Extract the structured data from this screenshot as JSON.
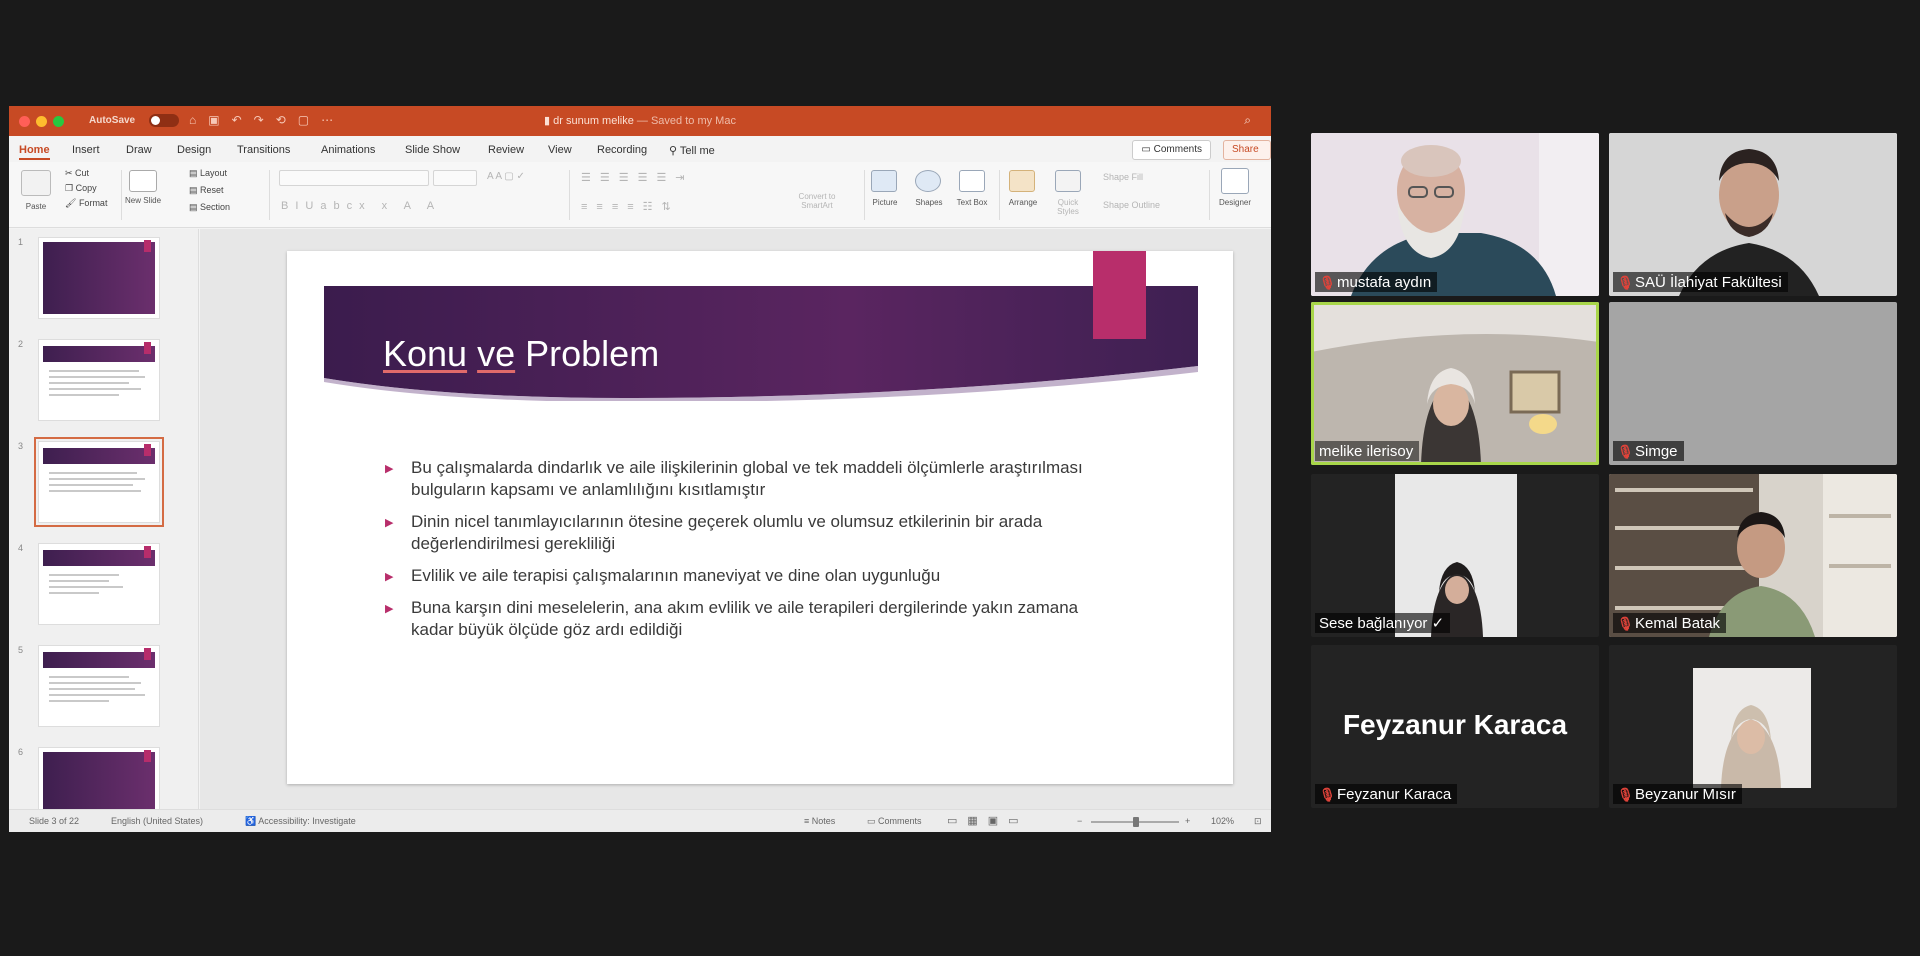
{
  "powerpoint": {
    "titlebar": {
      "autosave_label": "AutoSave",
      "autosave_state": "OFF",
      "document_title": "dr sunum melike",
      "saved_status": "— Saved to my Mac"
    },
    "tabs": [
      "Home",
      "Insert",
      "Draw",
      "Design",
      "Transitions",
      "Animations",
      "Slide Show",
      "Review",
      "View",
      "Recording",
      "Tell me"
    ],
    "active_tab": "Home",
    "comments_button": "Comments",
    "share_button": "Share",
    "ribbon": {
      "paste": "Paste",
      "cut": "Cut",
      "copy": "Copy",
      "format": "Format",
      "new_slide": "New Slide",
      "layout": "Layout",
      "reset": "Reset",
      "section": "Section",
      "convert_smartart": "Convert to SmartArt",
      "picture": "Picture",
      "shapes": "Shapes",
      "text_box": "Text Box",
      "arrange": "Arrange",
      "quick_styles": "Quick Styles",
      "shape_fill": "Shape Fill",
      "shape_outline": "Shape Outline",
      "designer": "Designer"
    },
    "thumbnails": [
      {
        "num": "1"
      },
      {
        "num": "2"
      },
      {
        "num": "3"
      },
      {
        "num": "4"
      },
      {
        "num": "5"
      },
      {
        "num": "6"
      }
    ],
    "selected_slide": 3,
    "slide": {
      "title_part1": "Konu",
      "title_part2": "ve",
      "title_part3": "Problem",
      "bullets": [
        "Bu çalışmalarda dindarlık ve aile ilişkilerinin global ve tek maddeli ölçümlerle araştırılması bulguların kapsamı ve anlamlılığını kısıtlamıştır",
        "Dinin nicel tanımlayıcılarının ötesine geçerek olumlu ve olumsuz etkilerinin bir arada değerlendirilmesi gerekliliği",
        "Evlilik ve aile terapisi çalışmalarının maneviyat ve dine olan uygunluğu",
        "Buna karşın dini meselelerin, ana akım evlilik ve aile terapileri dergilerinde yakın zamana kadar büyük ölçüde göz ardı edildiği"
      ]
    },
    "statusbar": {
      "slide_info": "Slide 3 of 22",
      "language": "English (United States)",
      "accessibility": "Accessibility: Investigate",
      "notes": "Notes",
      "comments": "Comments",
      "zoom": "102%"
    }
  },
  "participants": [
    {
      "name": "mustafa aydın",
      "muted": true,
      "video": true
    },
    {
      "name": "SAÜ İlahiyat Fakültesi",
      "muted": true,
      "video": true
    },
    {
      "name": "melike ilerisoy",
      "muted": false,
      "video": true,
      "speaking": true
    },
    {
      "name": "Simge",
      "muted": true,
      "video": false
    },
    {
      "name": "Sese bağlanıyor",
      "muted": false,
      "video": true,
      "status_icon": "check-icon"
    },
    {
      "name": "Kemal Batak",
      "muted": true,
      "video": true
    },
    {
      "name": "Feyzanur Karaca",
      "muted": true,
      "video": false,
      "display_name": "Feyzanur Karaca"
    },
    {
      "name": "Beyzanur Mısır",
      "muted": true,
      "video": true
    }
  ],
  "colors": {
    "ppt_accent": "#c74a24",
    "slide_banner": "#4a2358",
    "slide_tag": "#b82e6b",
    "speaker_outline": "#a8d64a",
    "mute_red": "#e0433a"
  }
}
